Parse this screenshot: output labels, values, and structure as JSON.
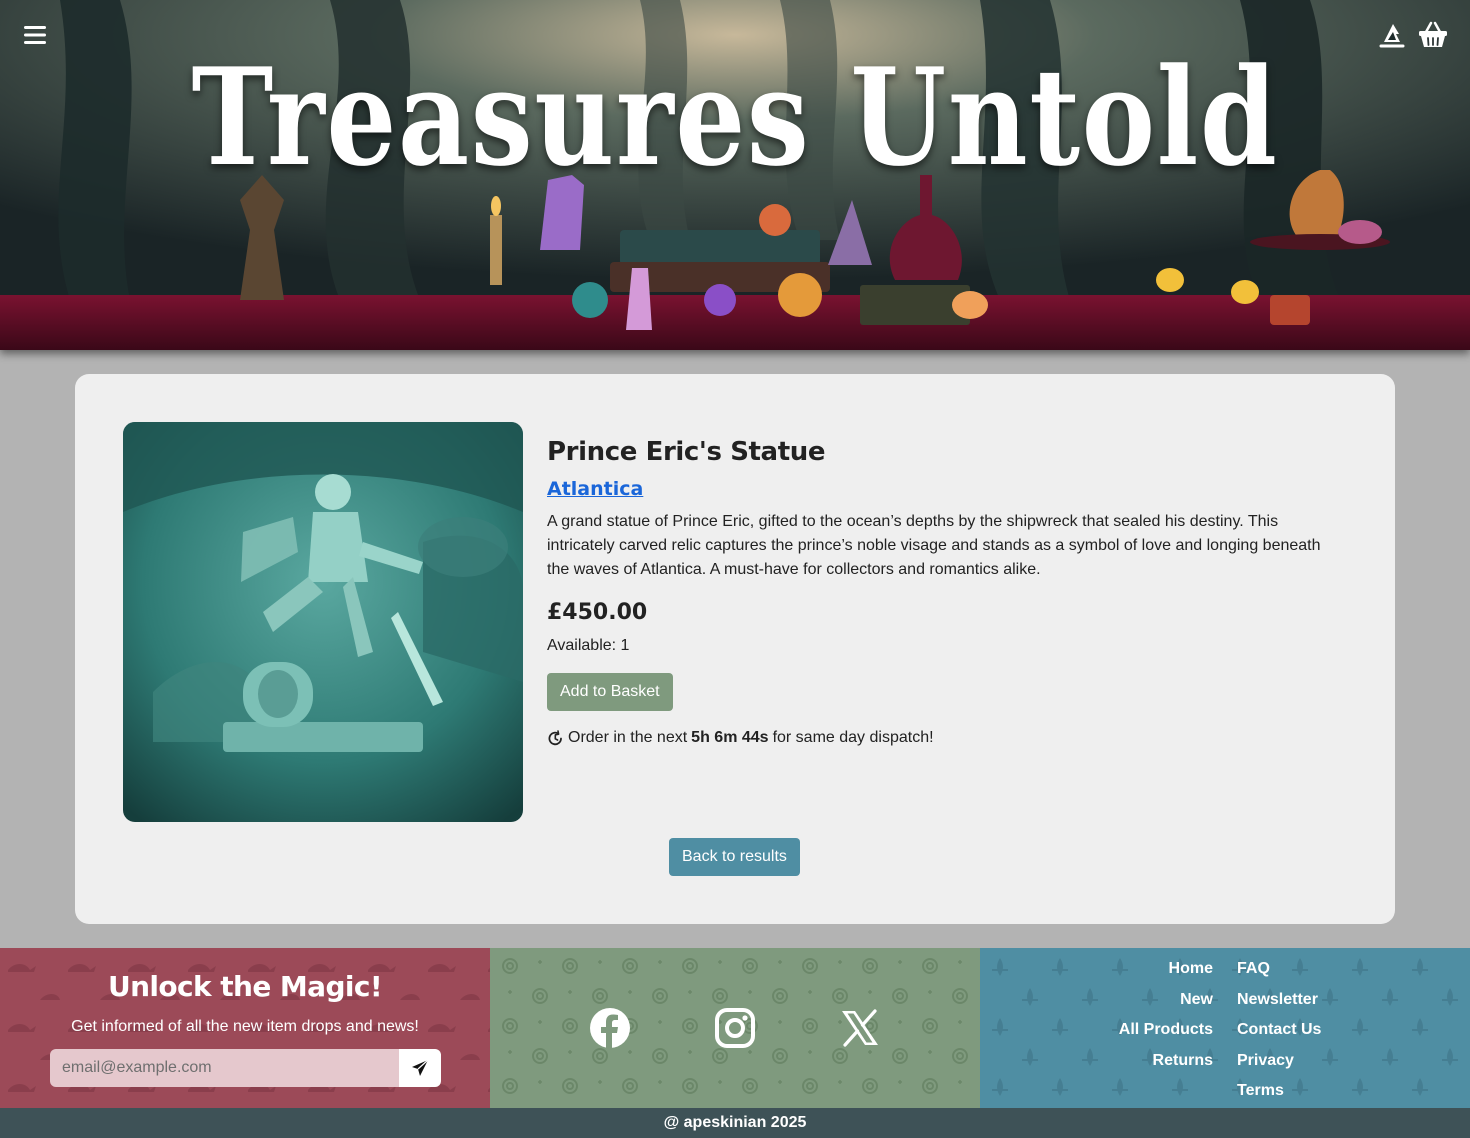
{
  "header": {
    "title": "Treasures Untold",
    "menu_icon": "hamburger-menu-icon",
    "account_icon": "wizard-hat-icon",
    "basket_icon": "basket-icon"
  },
  "product": {
    "name": "Prince Eric's Statue",
    "category": "Atlantica",
    "description": "A grand statue of Prince Eric, gifted to the ocean’s depths by the shipwreck that sealed his destiny. This intricately carved relic captures the prince’s noble visage and stands as a symbol of love and longing beneath the waves of Atlantica. A must-have for collectors and romantics alike.",
    "price": "£450.00",
    "available": "Available: 1",
    "add_to_basket": "Add to Basket",
    "dispatch_prefix": "Order in the next",
    "dispatch_time": "5h 6m 44s",
    "dispatch_suffix": "for same day dispatch!",
    "back_to_results": "Back to results"
  },
  "footer": {
    "newsletter": {
      "title": "Unlock the Magic!",
      "subtitle": "Get informed of all the new item drops and news!",
      "placeholder": "email@example.com"
    },
    "social": [
      "facebook-icon",
      "instagram-icon",
      "x-icon"
    ],
    "links_left": [
      "Home",
      "New",
      "All Products",
      "Returns"
    ],
    "links_right": [
      "FAQ",
      "Newsletter",
      "Contact Us",
      "Privacy",
      "Terms"
    ],
    "copyright": "@ apeskinian 2025"
  },
  "colors": {
    "card": "#efefef",
    "page": "#b3b3b3",
    "add_button": "#7f9a7e",
    "back_button": "#4f8ea3",
    "footer_red": "#9c4a58",
    "footer_green": "#7f9a7e",
    "footer_blue": "#4f8ea3",
    "copyright_bar": "#3e5257",
    "link": "#1a66d9"
  }
}
